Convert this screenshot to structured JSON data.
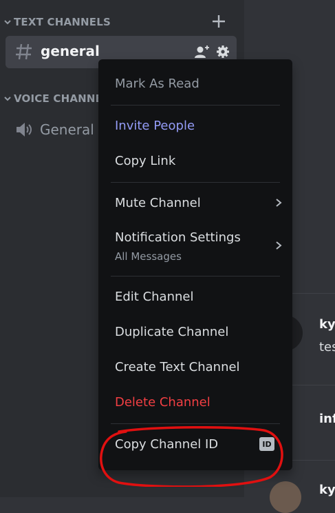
{
  "sidebar": {
    "text_category": "TEXT CHANNELS",
    "voice_category": "VOICE CHANNE",
    "active_channel": "general",
    "voice_channel": "General"
  },
  "chat": {
    "author1": "ky",
    "msg1": "tes",
    "author2": "inf",
    "author3": "ky"
  },
  "context_menu": {
    "mark_as_read": "Mark As Read",
    "invite_people": "Invite People",
    "copy_link": "Copy Link",
    "mute_channel": "Mute Channel",
    "notification_settings": "Notification Settings",
    "notification_value": "All Messages",
    "edit_channel": "Edit Channel",
    "duplicate_channel": "Duplicate Channel",
    "create_text_channel": "Create Text Channel",
    "delete_channel": "Delete Channel",
    "copy_channel_id": "Copy Channel ID",
    "id_badge": "ID"
  },
  "colors": {
    "accent_purple": "#949cf7",
    "danger_red": "#f23f43",
    "annotation_red": "#e01010"
  }
}
